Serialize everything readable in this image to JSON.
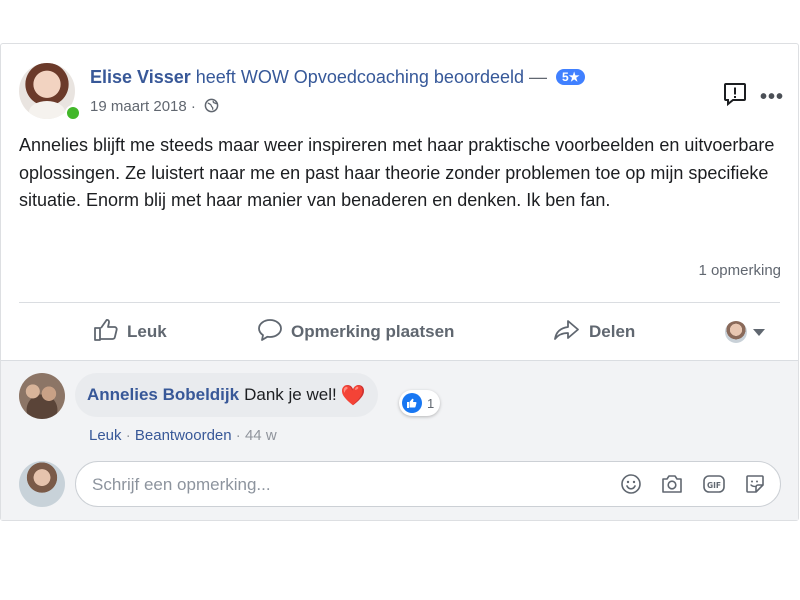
{
  "post": {
    "author": "Elise Visser",
    "verb": "heeft",
    "target": "WOW Opvoedcoaching",
    "action": "beoordeeld",
    "dash": "—",
    "rating": "5★",
    "date": "19 maart 2018",
    "dot": "·",
    "audience_icon": "globe-icon",
    "text": "Annelies blijft me steeds maar weer inspireren met haar praktische voorbeelden en uitvoerbare oplossingen. Ze luistert naar me en past haar theorie zonder problemen toe op mijn specifieke situatie. Enorm blij met haar manier van benaderen en denken. Ik ben fan.",
    "comment_count": "1 opmerking"
  },
  "actions": {
    "like": "Leuk",
    "comment": "Opmerking plaatsen",
    "share": "Delen"
  },
  "comment": {
    "author": "Annelies Bobeldijk",
    "text": "Dank je wel!",
    "emoji": "❤️",
    "reaction_count": "1",
    "like_link": "Leuk",
    "reply_link": "Beantwoorden",
    "sep": "·",
    "time": "44 w"
  },
  "composer": {
    "placeholder": "Schrijf een opmerking..."
  },
  "colors": {
    "link": "#385898",
    "badge": "#4080ff",
    "online": "#42b72a",
    "like_blue": "#1877f2"
  }
}
